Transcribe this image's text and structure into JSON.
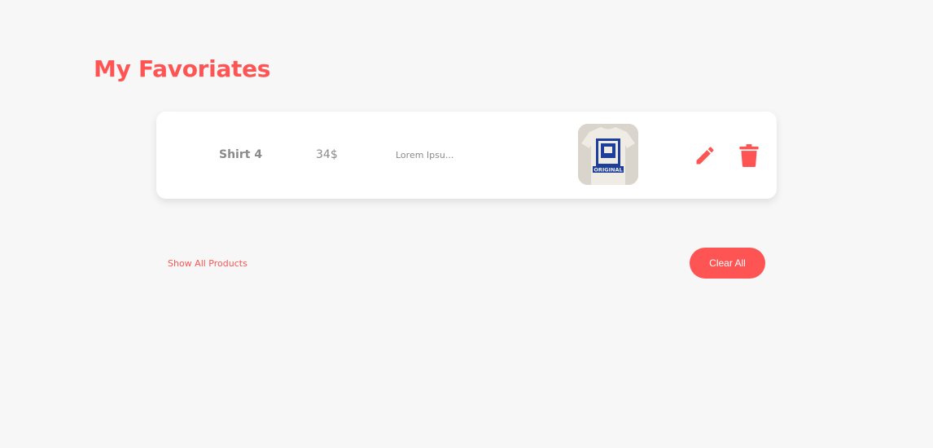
{
  "page": {
    "title": "My Favoriates"
  },
  "favorites": [
    {
      "name": "Shirt 4",
      "price": "34$",
      "description": "Lorem Ipsu...",
      "image_text": "ORIGINAL"
    }
  ],
  "actions": {
    "show_all_label": "Show All Products",
    "clear_all_label": "Clear All"
  },
  "icons": {
    "edit": "pencil-icon",
    "delete": "trash-icon"
  },
  "colors": {
    "accent": "#fe5454",
    "background": "#f7f7f7",
    "card": "#ffffff",
    "muted_text": "#8a8a8a",
    "shirt_print": "#1d3f9a"
  }
}
